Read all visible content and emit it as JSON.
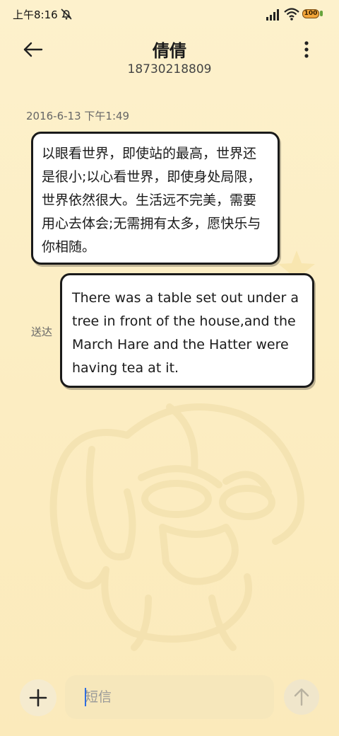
{
  "status_bar": {
    "time": "上午8:16",
    "icons": [
      "mute-icon",
      "signal-icon",
      "wifi-icon",
      "battery-icon"
    ],
    "battery_level": "100"
  },
  "header": {
    "back_icon": "arrow-left-icon",
    "contact_name": "倩倩",
    "contact_number": "18730218809",
    "more_icon": "more-vertical-icon"
  },
  "conversation": {
    "timestamp": "2016-6-13 下午1:49",
    "messages": [
      {
        "direction": "received",
        "lines": [
          "以眼看世界，即使站的最高，世界还",
          "是很小;以心看世界，即使身处局限，",
          "世界依然很大。生活远不完美，需要",
          "用心去体会;无需拥有太多，愿快乐与",
          "你相随。"
        ]
      },
      {
        "direction": "sent",
        "status": "送达",
        "lines": [
          "There was a table set out under a",
          "tree in front of the house,and the",
          "March Hare and the Hatter were",
          "having tea at it."
        ]
      }
    ]
  },
  "composer": {
    "add_icon": "plus-icon",
    "input_value": "",
    "placeholder": "短信",
    "send_icon": "arrow-up-icon"
  },
  "colors": {
    "background": "#fdf1cc",
    "bubble": "#ffffff",
    "bubble_border": "#1a1a1a",
    "caret": "#2f6de0"
  }
}
